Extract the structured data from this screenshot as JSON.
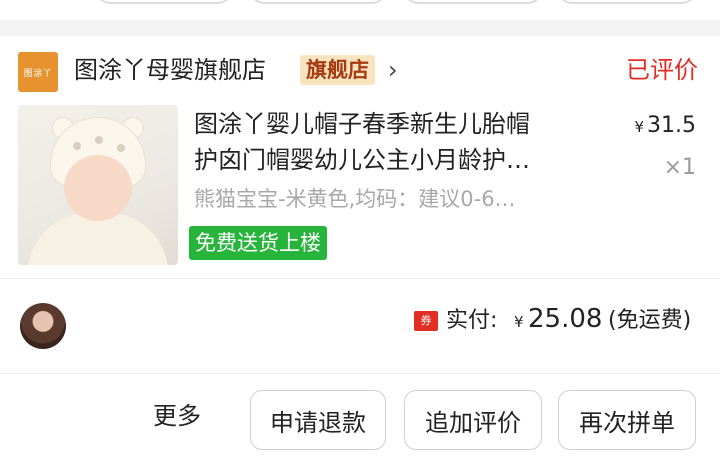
{
  "store": {
    "logo_text": "图涂丫",
    "name": "图涂丫母婴旗舰店",
    "badge": "旗舰店",
    "chevron": "›",
    "status": "已评价"
  },
  "product": {
    "image_icon": "baby-hat-photo",
    "title_line1": "图涂丫婴儿帽子春季新生儿胎帽",
    "title_line2": "护囟门帽婴幼儿公主小月龄护…",
    "price_currency": "¥",
    "price": "31.5",
    "quantity": "×1",
    "spec": "熊猫宝宝-米黄色,均码：建议0-6…",
    "delivery_tag": "免费送货上楼"
  },
  "payment": {
    "coupon_icon": "券",
    "paid_label": "实付:",
    "currency": "¥",
    "amount": "25.08",
    "shipping_note": "(免运费)"
  },
  "actions": {
    "more": "更多",
    "refund": "申请退款",
    "add_review": "追加评价",
    "rebuy": "再次拼单"
  },
  "colors": {
    "accent_red": "#e02e24",
    "green_tag": "#27b43b",
    "badge_bg": "#f8e5bf",
    "logo_orange": "#e6922f"
  }
}
